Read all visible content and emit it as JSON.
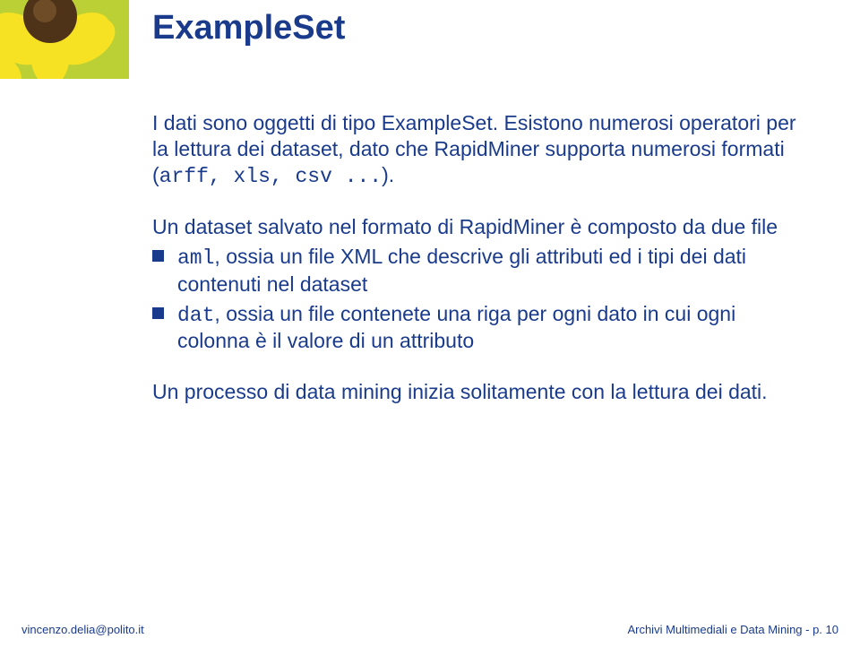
{
  "title": "ExampleSet",
  "para1_pre": "I dati sono oggetti di tipo ExampleSet. Esistono numerosi operatori per la lettura dei dataset, dato che RapidMiner supporta numerosi formati (",
  "para1_mono": "arff, xls, csv ...",
  "para1_post": ").",
  "list_intro": "Un dataset salvato nel formato di RapidMiner è composto da due file",
  "items": [
    {
      "mono": "aml",
      "rest": ", ossia un file XML che descrive gli attributi ed i tipi dei dati contenuti nel dataset"
    },
    {
      "mono": "dat",
      "rest": ", ossia un file contenete una riga per ogni dato in cui ogni colonna è il valore di un attributo"
    }
  ],
  "para2": "Un processo di data mining inizia solitamente con la lettura dei dati.",
  "footer_left": "vincenzo.delia@polito.it",
  "footer_right": "Archivi Multimediali e Data Mining - p. 10"
}
